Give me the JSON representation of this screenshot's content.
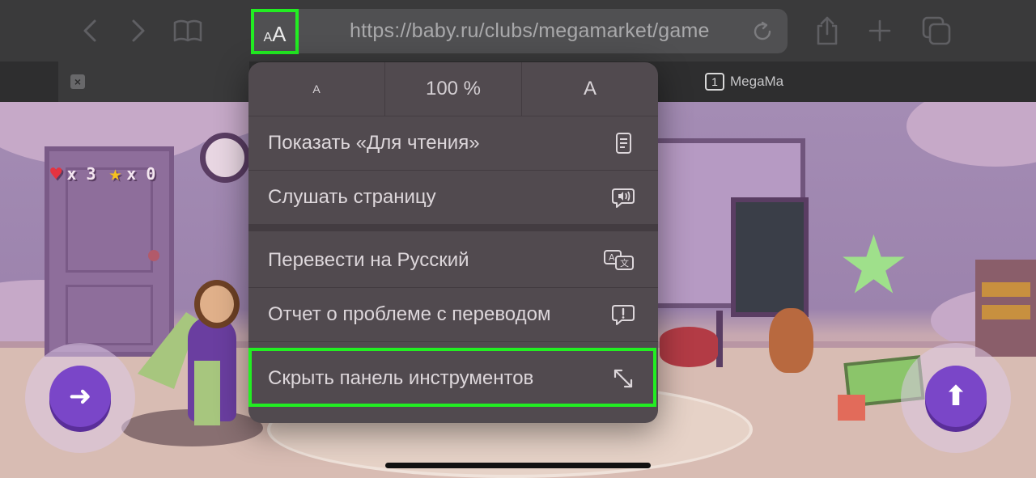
{
  "browser": {
    "url": "https://baby.ru/clubs/megamarket/game",
    "reader_button": {
      "small": "A",
      "large": "A"
    },
    "nav_icons": [
      "back-icon",
      "forward-icon",
      "bookmarks-icon"
    ],
    "action_icons": [
      "share-icon",
      "new-tab-icon",
      "tabs-icon"
    ]
  },
  "tabs": {
    "close_label": "×",
    "second_tab": {
      "count": "1",
      "label": "MegaMa"
    }
  },
  "menu": {
    "zoom": {
      "smaller": "A",
      "level": "100 %",
      "bigger": "A"
    },
    "items": [
      {
        "label": "Показать «Для чтения»",
        "icon": "reader-icon"
      },
      {
        "label": "Слушать страницу",
        "icon": "speaker-bubble-icon"
      },
      {
        "label": "Перевести на Русский",
        "icon": "translate-icon"
      },
      {
        "label": "Отчет о проблеме с переводом",
        "icon": "report-bubble-icon"
      },
      {
        "label": "Скрыть панель инструментов",
        "icon": "expand-arrows-icon"
      }
    ],
    "highlighted_item": "Скрыть панель инструментов"
  },
  "game": {
    "lives": "x 3",
    "stars": "x 0",
    "left_button_icon": "right-arrow-icon",
    "right_button_icon": "up-arrow-icon"
  },
  "colors": {
    "highlight": "#22ee22",
    "menu_bg": "#514a4f",
    "game_button": "#7a46c8"
  }
}
